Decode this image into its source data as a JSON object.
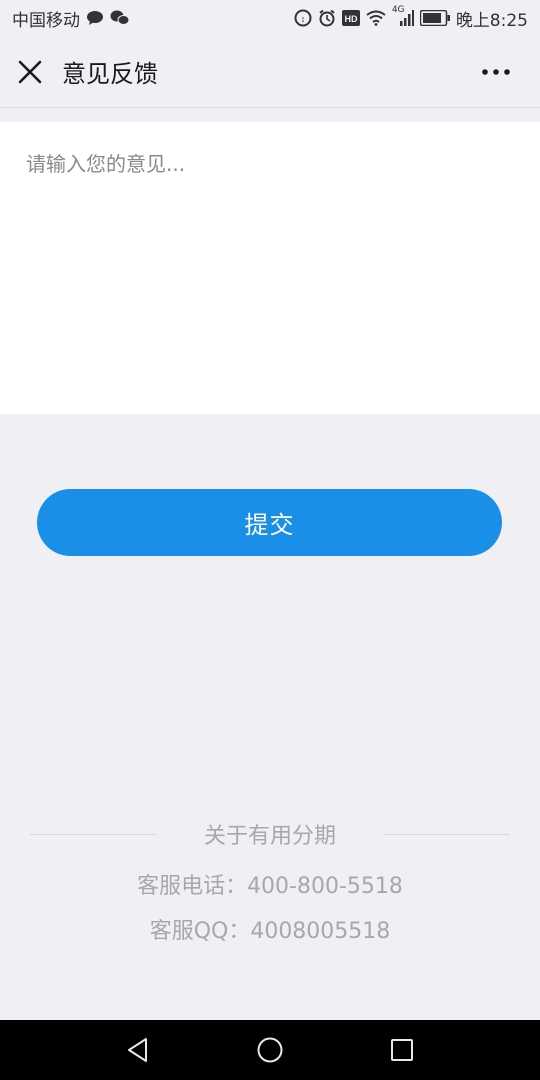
{
  "status_bar": {
    "carrier": "中国移动",
    "time": "晚上8:25",
    "network": "4G",
    "icons": [
      "chat-bubble-icon",
      "wechat-icon",
      "data-saver-icon",
      "alarm-icon",
      "hd-icon",
      "wifi-icon",
      "signal-icon",
      "battery-icon"
    ]
  },
  "header": {
    "title": "意见反馈",
    "close_icon": "close-icon",
    "more_icon": "more-icon"
  },
  "feedback": {
    "placeholder": "请输入您的意见...",
    "value": ""
  },
  "submit": {
    "label": "提交",
    "color": "#1a8fe8"
  },
  "footer": {
    "about": "关于有用分期",
    "phone": "客服电话：400-800-5518",
    "qq": "客服QQ：4008005518"
  },
  "system_nav": {
    "icons": [
      "back-icon",
      "home-icon",
      "recents-icon"
    ]
  }
}
